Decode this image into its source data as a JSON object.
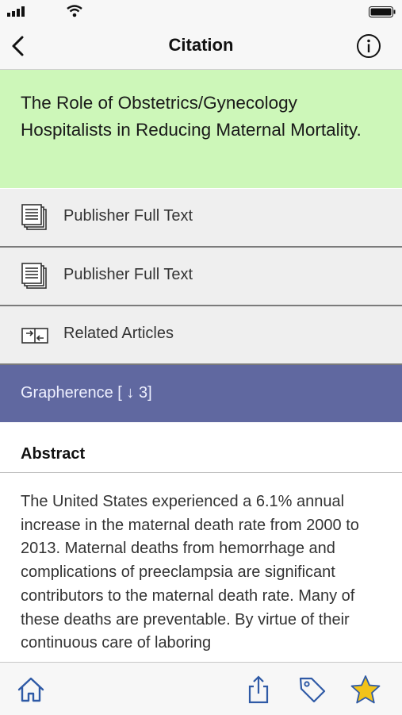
{
  "nav": {
    "title": "Citation"
  },
  "article": {
    "title": "The Role of Obstetrics/Gynecology Hospitalists in Reducing Maternal Mortality."
  },
  "links": [
    {
      "label": "Publisher Full Text",
      "icon": "document-stack-icon"
    },
    {
      "label": "Publisher Full Text",
      "icon": "document-stack-icon"
    },
    {
      "label": "Related Articles",
      "icon": "related-articles-icon"
    }
  ],
  "grapherence": {
    "label": "Grapherence [ ↓ 3]"
  },
  "abstract": {
    "heading": "Abstract",
    "text": "The United States experienced a 6.1% annual increase in the maternal death rate from 2000 to 2013. Maternal deaths from hemorrhage and complications of preeclampsia are significant contributors to the maternal death rate. Many of these deaths are preventable. By virtue of their continuous care of laboring"
  },
  "tabbar": {
    "icons": [
      "home-icon",
      "share-icon",
      "tag-icon",
      "star-icon"
    ]
  },
  "colors": {
    "title_bg": "#cdf7b9",
    "grapherence_bg": "#6068a0",
    "star": "#f2c318",
    "tab_icon": "#2f5aa6"
  }
}
